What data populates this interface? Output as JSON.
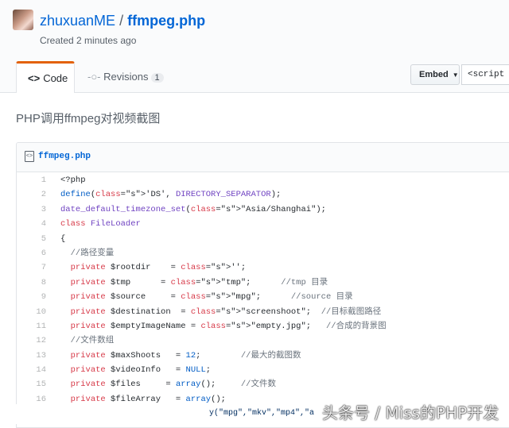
{
  "header": {
    "owner": "zhuxuanME",
    "separator": "/",
    "gist_name": "ffmpeg.php",
    "created": "Created 2 minutes ago"
  },
  "tabs": {
    "code_label": "Code",
    "code_icon": "<>",
    "revisions_label": "Revisions",
    "revisions_count": "1"
  },
  "embed": {
    "label": "Embed",
    "value": "<script s"
  },
  "description": "PHP调用ffmpeg对视频截图",
  "file": {
    "name": "ffmpeg.php",
    "icon": "code-file-icon",
    "lines": [
      {
        "n": "1",
        "t": "<?php"
      },
      {
        "n": "2",
        "t": "define('DS', DIRECTORY_SEPARATOR);"
      },
      {
        "n": "3",
        "t": "date_default_timezone_set(\"Asia/Shanghai\");"
      },
      {
        "n": "4",
        "t": "class FileLoader"
      },
      {
        "n": "5",
        "t": "{"
      },
      {
        "n": "6",
        "t": "  //路径变量"
      },
      {
        "n": "7",
        "t": "  private $rootdir    = '';"
      },
      {
        "n": "8",
        "t": "  private $tmp      = \"tmp\";      //tmp 目录"
      },
      {
        "n": "9",
        "t": "  private $source     = \"mpg\";      //source 目录"
      },
      {
        "n": "10",
        "t": "  private $destination  = \"screenshoot\";  //目标截图路径"
      },
      {
        "n": "11",
        "t": "  private $emptyImageName = \"empty.jpg\";   //合成的背景图"
      },
      {
        "n": "12",
        "t": "  //文件数组"
      },
      {
        "n": "13",
        "t": "  private $maxShoots   = 12;        //最大的截图数"
      },
      {
        "n": "14",
        "t": "  private $videoInfo   = NULL;"
      },
      {
        "n": "15",
        "t": "  private $files     = array();     //文件数"
      },
      {
        "n": "16",
        "t": "  private $fileArray   = array();"
      }
    ],
    "tail": "y(\"mpg\",\"mkv\",\"mp4\",\"a"
  },
  "watermark": "头条号 / Miss的PHP开发",
  "colors": {
    "link": "#0366d6",
    "keyword": "#d73a49",
    "function": "#6f42c1",
    "string": "#032f62",
    "comment": "#6a737d",
    "tab_accent": "#e36209"
  }
}
